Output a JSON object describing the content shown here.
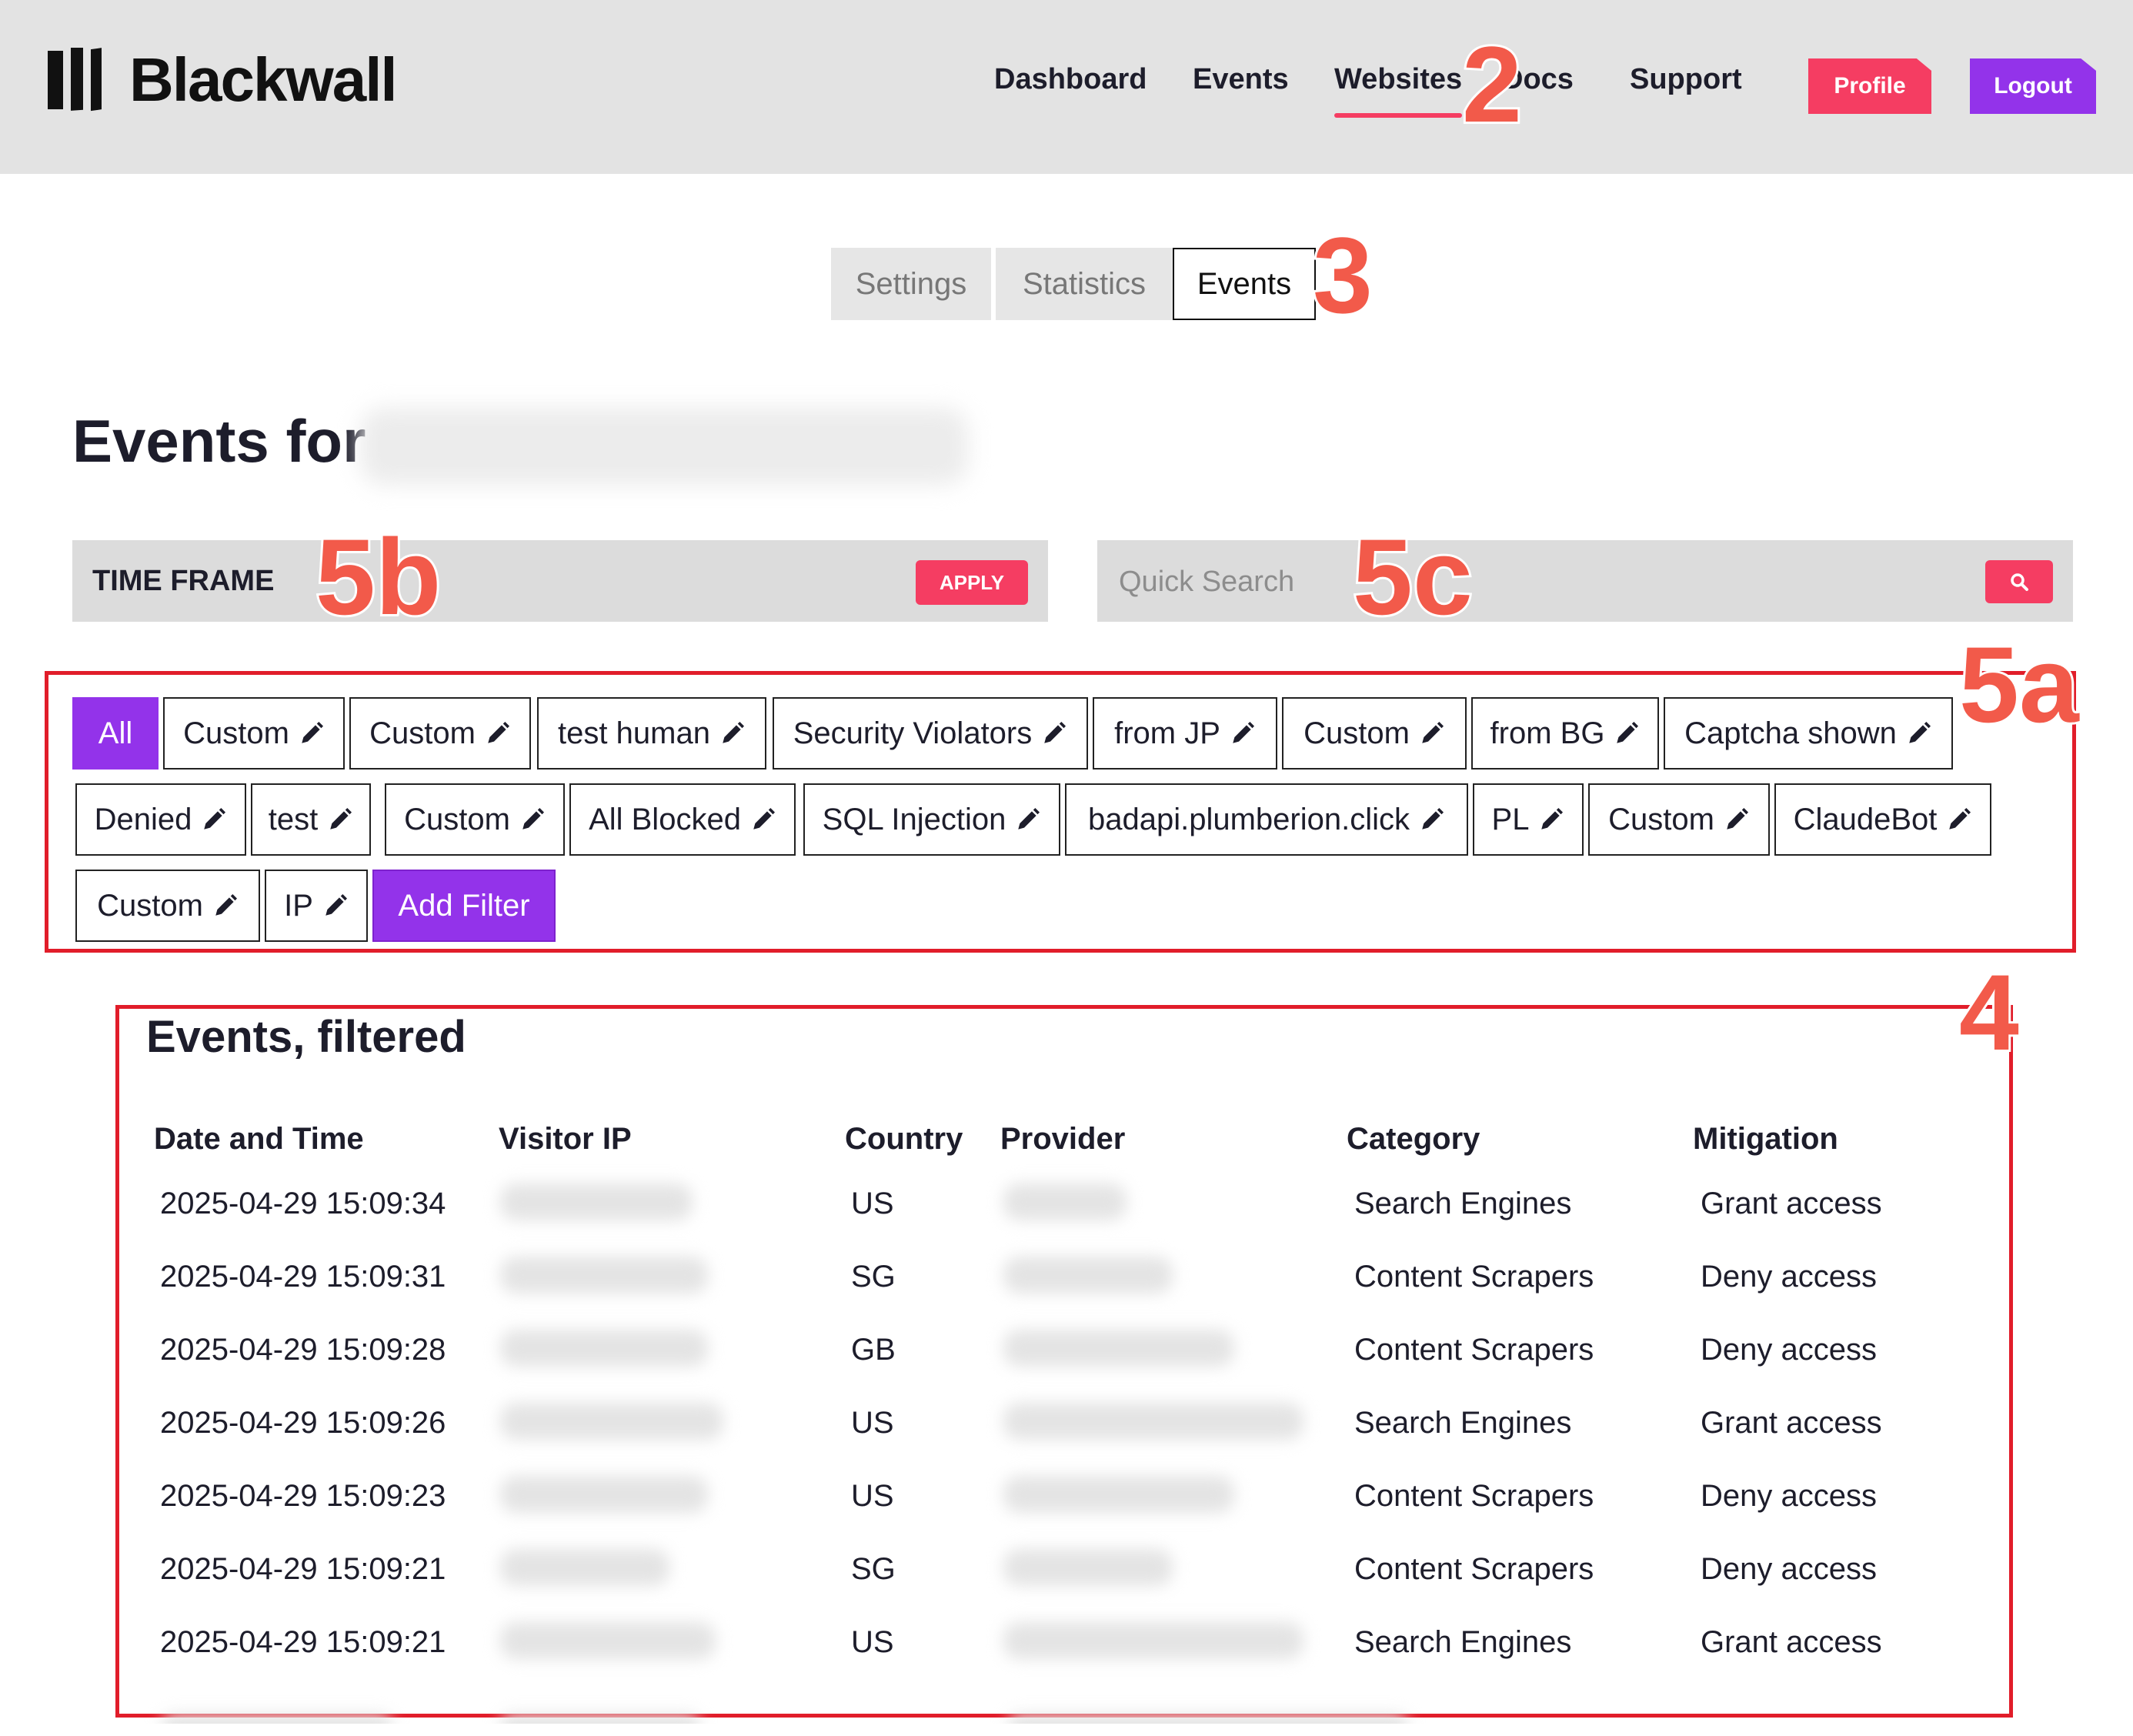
{
  "brand": {
    "name": "Blackwall"
  },
  "nav": {
    "items": [
      {
        "label": "Dashboard"
      },
      {
        "label": "Events"
      },
      {
        "label": "Websites"
      },
      {
        "label": "Docs"
      },
      {
        "label": "Support"
      }
    ],
    "active": "Websites",
    "profile_label": "Profile",
    "logout_label": "Logout"
  },
  "tabs": [
    {
      "label": "Settings"
    },
    {
      "label": "Statistics"
    },
    {
      "label": "Events"
    }
  ],
  "active_tab": "Events",
  "page": {
    "title": "Events for"
  },
  "timeframe": {
    "label": "TIME FRAME",
    "apply_label": "APPLY"
  },
  "search": {
    "placeholder": "Quick Search",
    "icon": "search-icon"
  },
  "filters": [
    "All",
    "Custom",
    "Custom",
    "test human",
    "Security Violators",
    "from JP",
    "Custom",
    "from BG",
    "Captcha shown",
    "Denied",
    "test",
    "Custom",
    "All Blocked",
    "SQL Injection",
    "badapi.plumberion.click",
    "PL",
    "Custom",
    "ClaudeBot",
    "Custom",
    "IP",
    "Add Filter"
  ],
  "events": {
    "title": "Events, filtered",
    "columns": [
      "Date and Time",
      "Visitor IP",
      "Country",
      "Provider",
      "Category",
      "Mitigation"
    ],
    "rows": [
      {
        "datetime": "2025-04-29 15:09:34",
        "country": "US",
        "category": "Search Engines",
        "mitigation": "Grant access"
      },
      {
        "datetime": "2025-04-29 15:09:31",
        "country": "SG",
        "category": "Content Scrapers",
        "mitigation": "Deny access"
      },
      {
        "datetime": "2025-04-29 15:09:28",
        "country": "GB",
        "category": "Content Scrapers",
        "mitigation": "Deny access"
      },
      {
        "datetime": "2025-04-29 15:09:26",
        "country": "US",
        "category": "Search Engines",
        "mitigation": "Grant access"
      },
      {
        "datetime": "2025-04-29 15:09:23",
        "country": "US",
        "category": "Content Scrapers",
        "mitigation": "Deny access"
      },
      {
        "datetime": "2025-04-29 15:09:21",
        "country": "SG",
        "category": "Content Scrapers",
        "mitigation": "Deny access"
      },
      {
        "datetime": "2025-04-29 15:09:21",
        "country": "US",
        "category": "Search Engines",
        "mitigation": "Grant access"
      }
    ]
  },
  "annotations": [
    "2",
    "3",
    "5b",
    "5c",
    "5a",
    "4"
  ],
  "colors": {
    "accent_red": "#f53d62",
    "accent_purple": "#9333ea",
    "annotation": "#f25a4a",
    "frame": "#e11d2a"
  }
}
